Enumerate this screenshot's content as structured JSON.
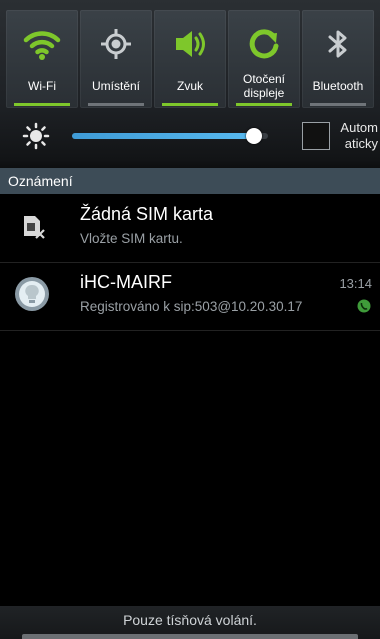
{
  "quick_settings": [
    {
      "label": "Wi-Fi",
      "icon": "wifi-icon",
      "on": true
    },
    {
      "label": "Umístění",
      "icon": "location-icon",
      "on": false
    },
    {
      "label": "Zvuk",
      "icon": "volume-icon",
      "on": true
    },
    {
      "label": "Otočení displeje",
      "icon": "rotate-icon",
      "on": true
    },
    {
      "label": "Bluetooth",
      "icon": "bluetooth-icon",
      "on": false
    }
  ],
  "brightness": {
    "level": 0.93,
    "auto_label": "Autom aticky",
    "auto_checked": false
  },
  "notifications": {
    "header": "Oznámení",
    "items": [
      {
        "title": "Žádná SIM karta",
        "subtitle": "Vložte SIM kartu.",
        "icon": "no-sim-icon",
        "time": ""
      },
      {
        "title": "iHC-MAIRF",
        "subtitle": "Registrováno k sip:503@10.20.30.17",
        "icon": "bulb-app-icon",
        "time": "13:14"
      }
    ]
  },
  "bottom": {
    "text": "Pouze tísňová volání."
  },
  "colors": {
    "accent_on": "#7ec72b",
    "slider": "#3f9bd6",
    "header_bg": "#3d4c57"
  }
}
